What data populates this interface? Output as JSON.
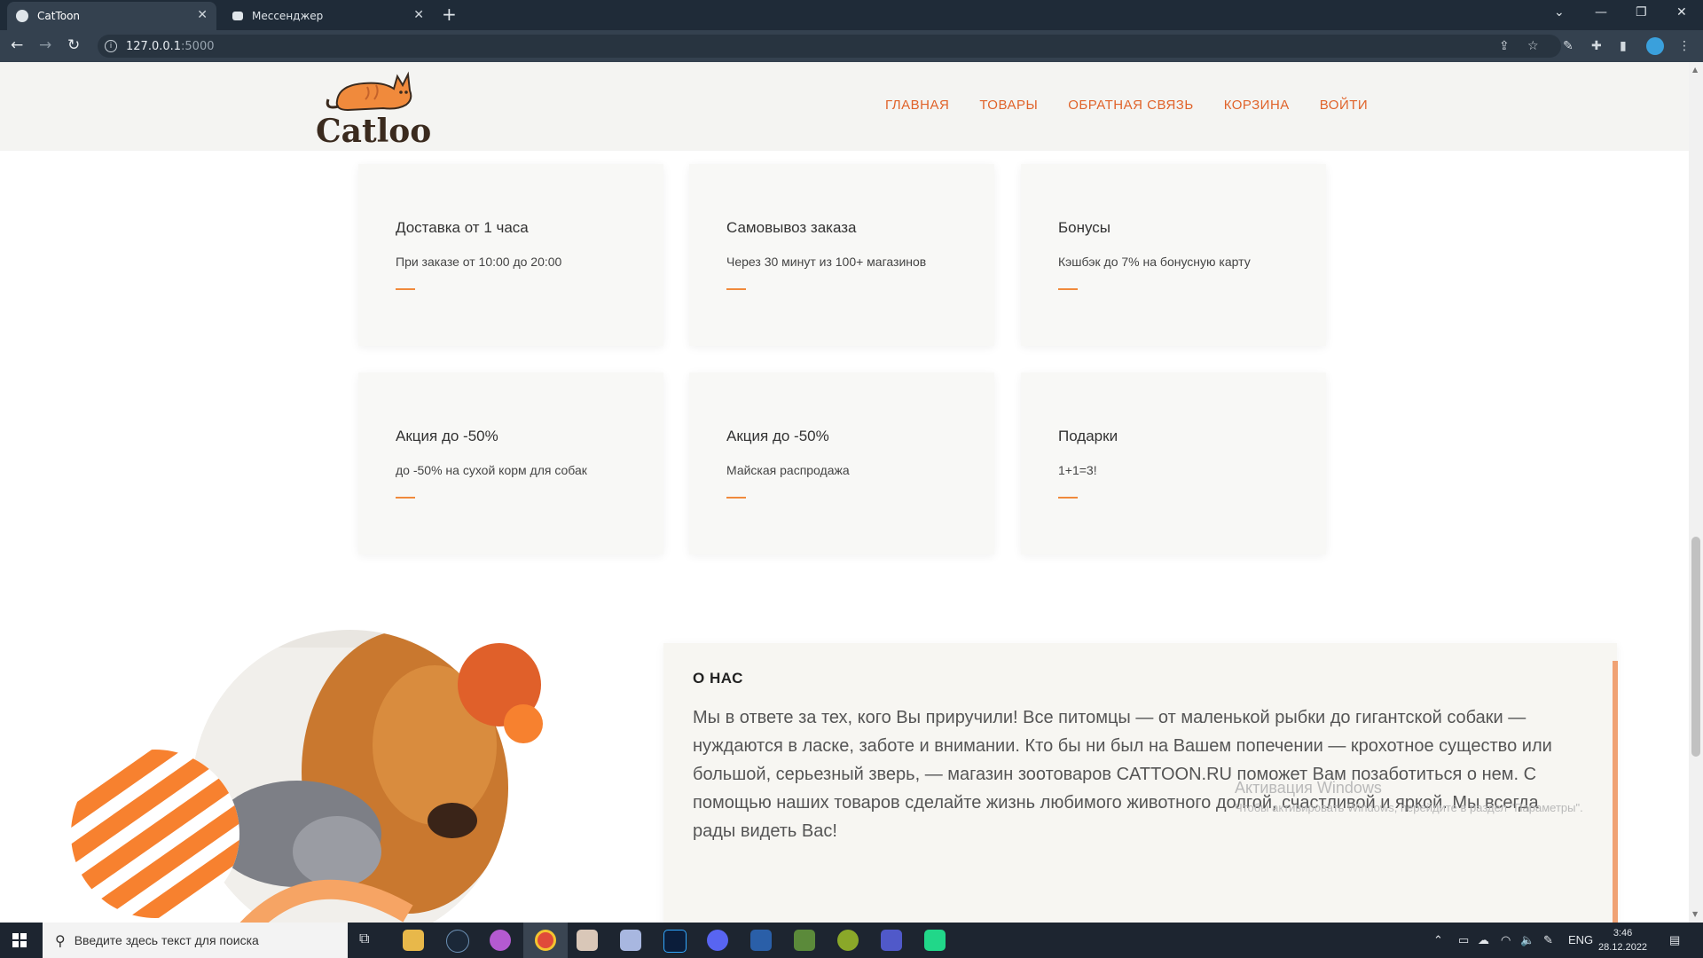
{
  "browser": {
    "tabs": [
      {
        "title": "CatToon",
        "active": true
      },
      {
        "title": "Мессенджер",
        "active": false
      }
    ],
    "url_host": "127.0.0.1",
    "url_port": ":5000"
  },
  "site": {
    "logo_text": "Catloon",
    "nav": [
      "ГЛАВНАЯ",
      "ТОВАРЫ",
      "ОБРАТНАЯ СВЯЗЬ",
      "КОРЗИНА",
      "ВОЙТИ"
    ],
    "accent": "#e0632a"
  },
  "cards": [
    {
      "title": "Доставка от 1 часа",
      "text": "При заказе от 10:00 до 20:00"
    },
    {
      "title": "Самовывоз заказа",
      "text": "Через 30 минут из 100+ магазинов"
    },
    {
      "title": "Бонусы",
      "text": "Кэшбэк до 7% на бонусную карту"
    },
    {
      "title": "Акция до -50%",
      "text": "до -50% на сухой корм для собак"
    },
    {
      "title": "Акция до -50%",
      "text": "Майская распродажа"
    },
    {
      "title": "Подарки",
      "text": "1+1=3!"
    }
  ],
  "about": {
    "title": "О НАС",
    "text": "Мы в ответе за тех, кого Вы приручили! Все питомцы — от маленькой рыбки до гигантской собаки — нуждаются в ласке, заботе и внимании. Кто бы ни был на Вашем попечении — крохотное существо или большой, серьезный зверь, — магазин зоотоваров CATTOON.RU поможет Вам позаботиться о нем. С помощью наших товаров сделайте жизнь любимого животного долгой, счастливой и яркой. Мы всегда рады видеть Вас!"
  },
  "watermark": {
    "line1": "Активация Windows",
    "line2": "Чтобы активировать Windows, перейдите в раздел \"Параметры\"."
  },
  "taskbar": {
    "search_placeholder": "Введите здесь текст для поиска",
    "lang": "ENG",
    "time": "3:46",
    "date": "28.12.2022"
  }
}
